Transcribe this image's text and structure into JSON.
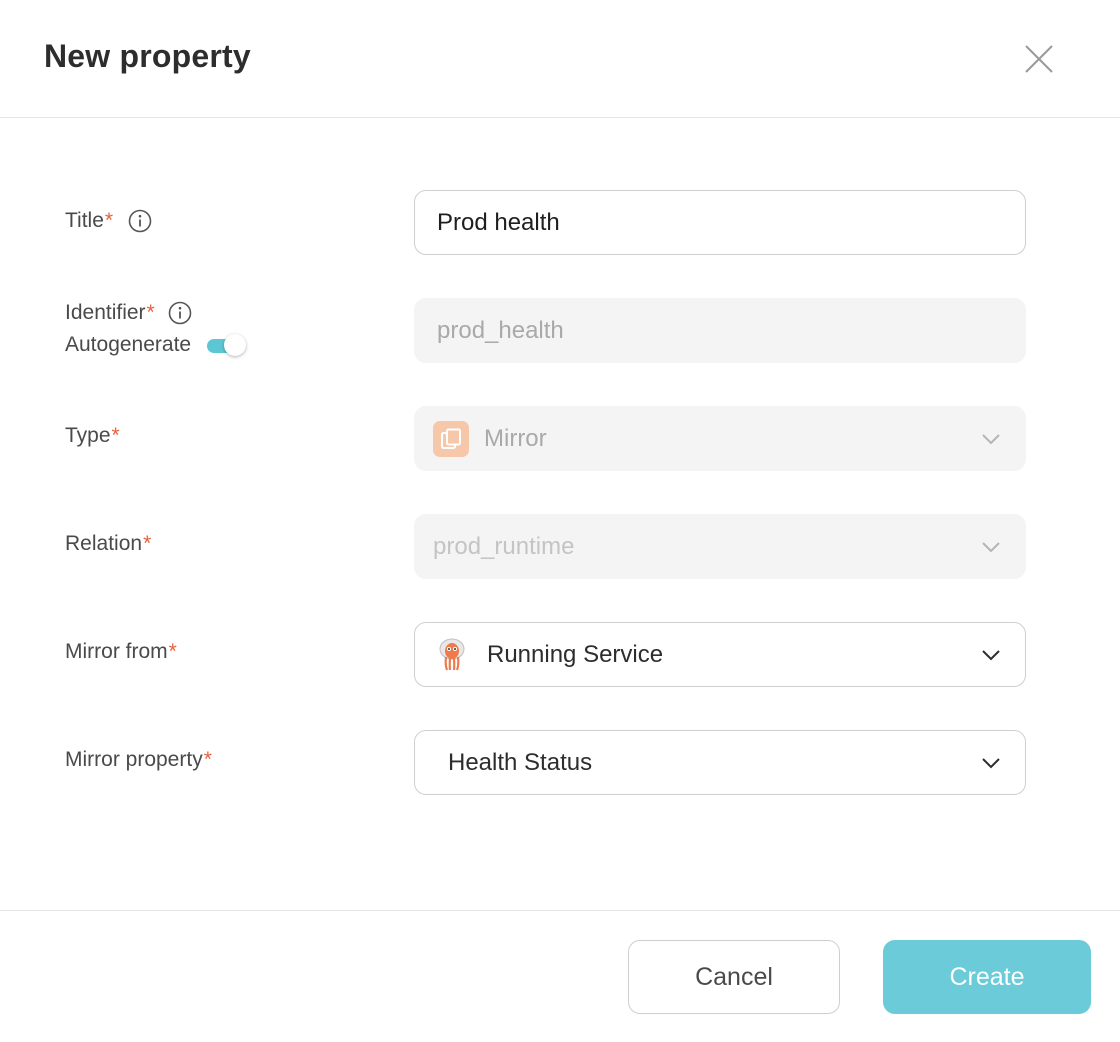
{
  "dialog": {
    "title": "New property",
    "close_icon": "close-icon"
  },
  "form": {
    "title": {
      "label": "Title",
      "required": "*",
      "value": "Prod health"
    },
    "identifier": {
      "label": "Identifier",
      "required": "*",
      "autogenerate_label": "Autogenerate",
      "autogenerate_on": true,
      "value": "prod_health"
    },
    "type": {
      "label": "Type",
      "required": "*",
      "value": "Mirror",
      "icon": "mirror-icon"
    },
    "relation": {
      "label": "Relation",
      "required": "*",
      "value": "prod_runtime"
    },
    "mirror_from": {
      "label": "Mirror from",
      "required": "*",
      "value": "Running Service",
      "icon": "octopus-icon"
    },
    "mirror_property": {
      "label": "Mirror property",
      "required": "*",
      "value": "Health Status"
    }
  },
  "footer": {
    "cancel_label": "Cancel",
    "create_label": "Create"
  },
  "colors": {
    "accent": "#6bcbd8",
    "required": "#e8603c",
    "toggle": "#5cc6d4",
    "mirror_icon_bg": "#f6c7a8"
  }
}
